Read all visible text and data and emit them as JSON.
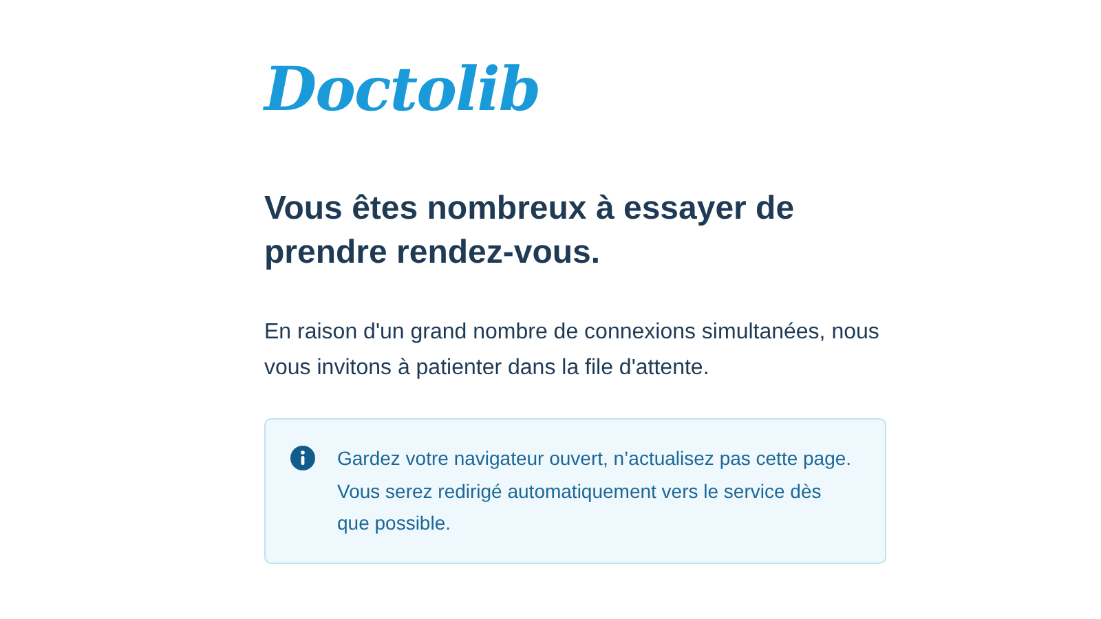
{
  "logo": {
    "text": "Doctolib"
  },
  "heading": "Vous êtes nombreux à essayer de prendre rendez-vous.",
  "message": "En raison d'un grand nombre de connexions simultanées, nous vous invitons à patienter dans la file d'attente.",
  "notice": {
    "text": "Gardez votre navigateur ouvert, n’actualisez pas cette page. Vous serez redirigé automatiquement vers le service dès que possible."
  }
}
